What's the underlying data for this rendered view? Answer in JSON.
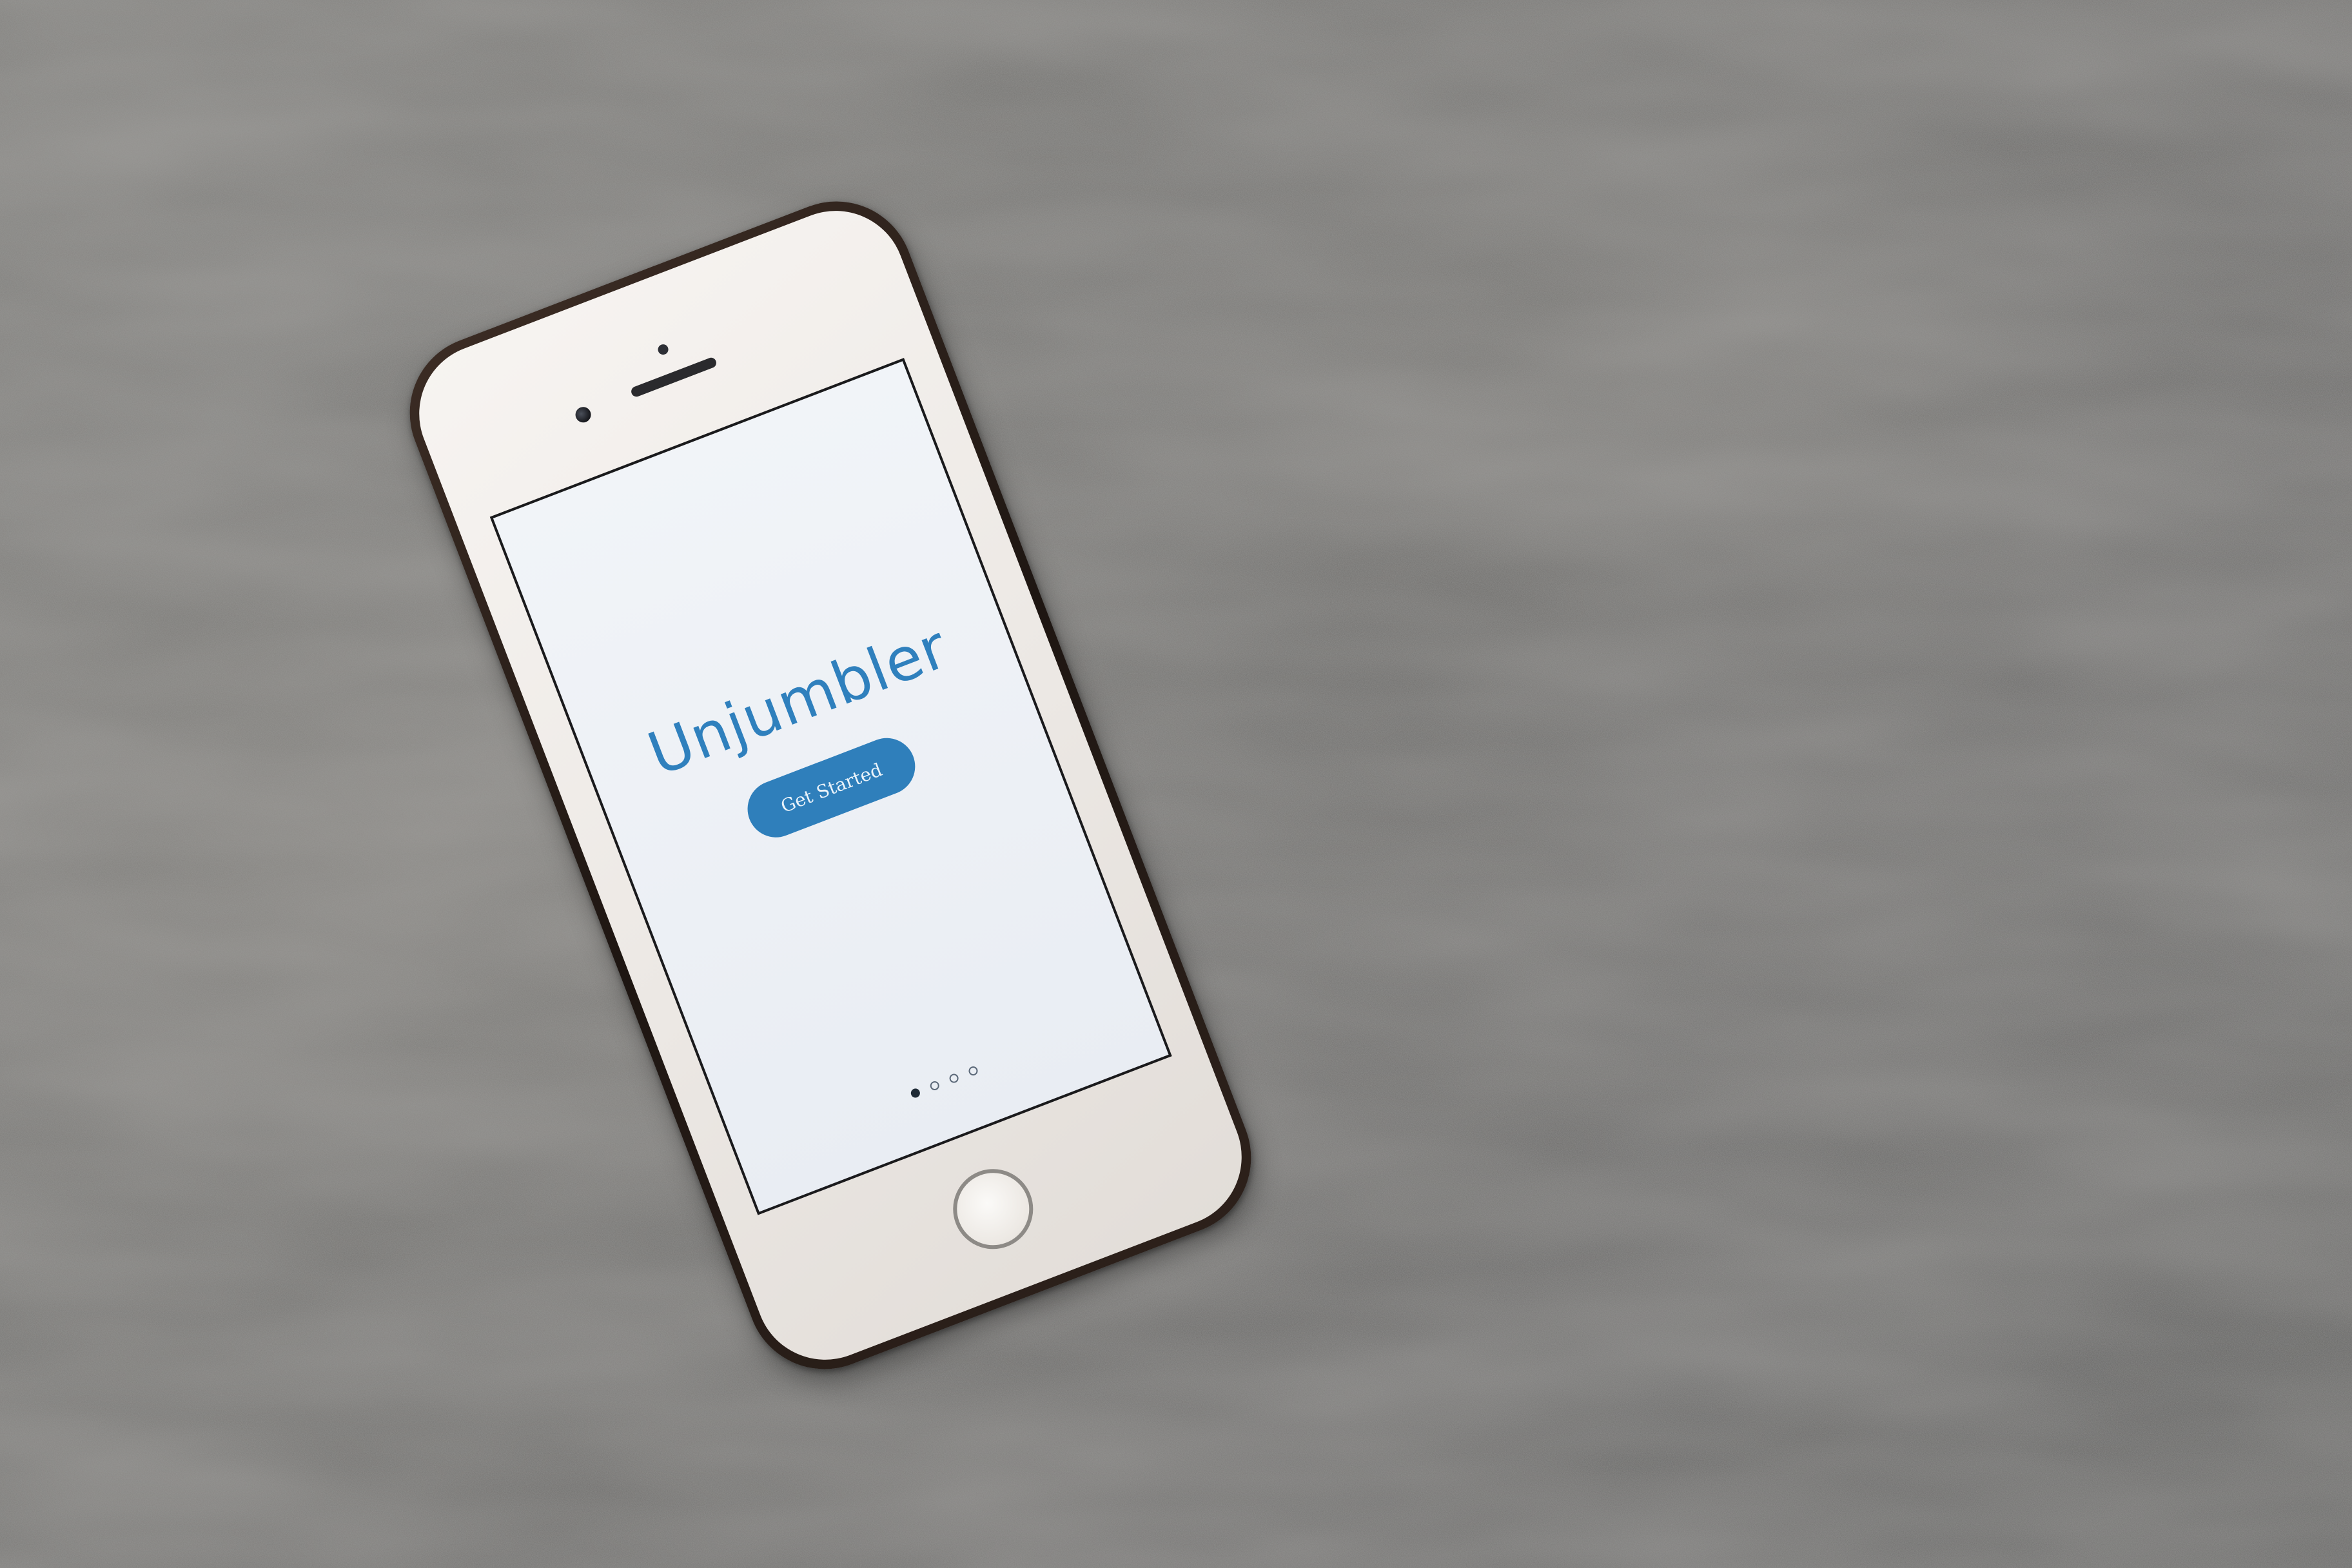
{
  "scene": {
    "background_color": "#6f6e6c",
    "accent_color": "#2f7fbb"
  },
  "app": {
    "title": "Unjumbler",
    "primary_button_label": "Get Started",
    "pager": {
      "page_count": 4,
      "active_index": 0
    }
  },
  "icons": {
    "home_button": "home-button-icon",
    "front_camera": "front-camera-icon",
    "earpiece": "speaker-icon"
  }
}
